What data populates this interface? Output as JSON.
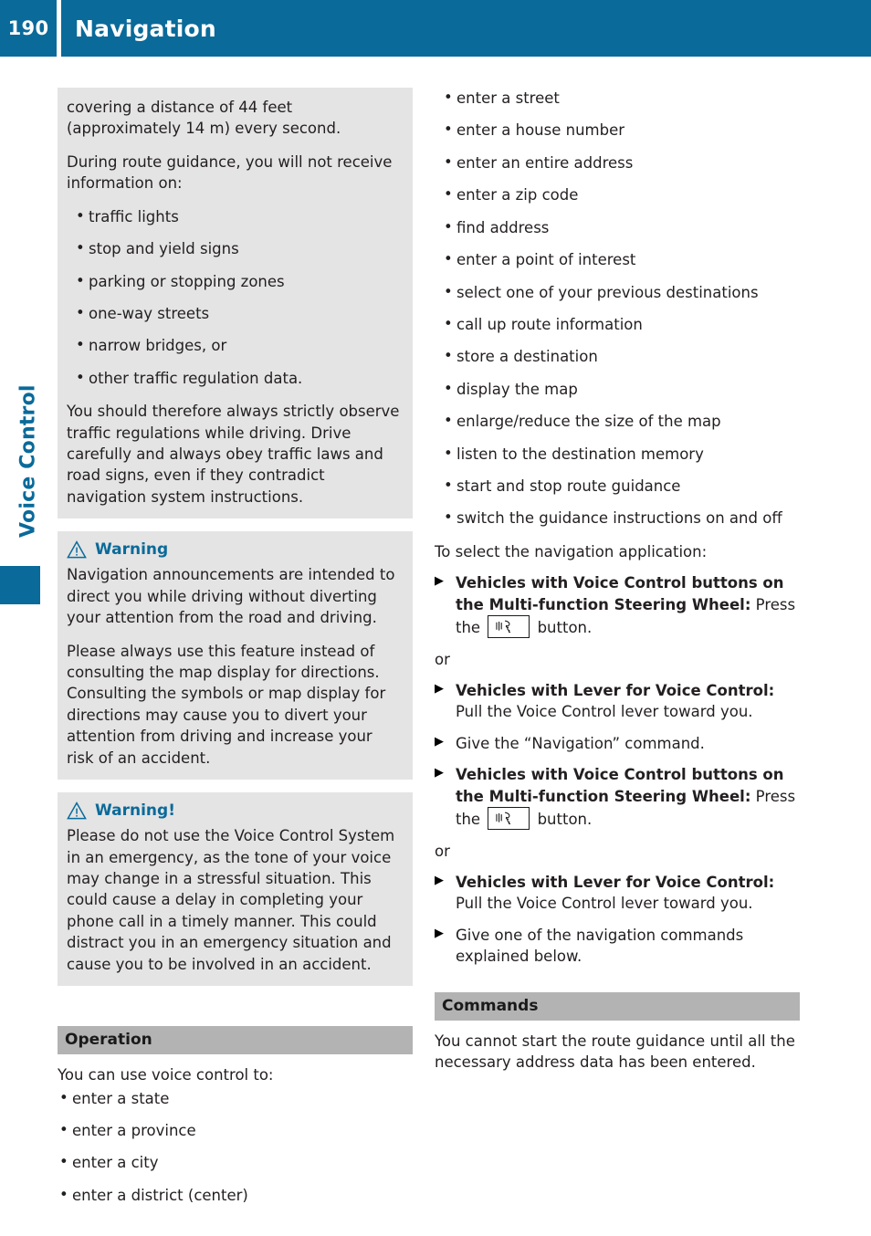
{
  "header": {
    "page_number": "190",
    "title": "Navigation",
    "bg_color": "#0a6a9a"
  },
  "side_tab": {
    "label": "Voice Control",
    "color": "#0a6a9a"
  },
  "left_column": {
    "intro_block": {
      "paragraphs": [
        "covering a distance of 44 feet (approximately 14 m) every second.",
        "During route guidance, you will not receive information on:"
      ],
      "bullets": [
        "traffic lights",
        "stop and yield signs",
        "parking or stopping zones",
        "one-way streets",
        "narrow bridges, or",
        "other traffic regulation data."
      ],
      "closing": "You should therefore always strictly observe traffic regulations while driving. Drive carefully and always obey traffic laws and road signs, even if they contradict navigation system instructions."
    },
    "warning_1": {
      "icon": "warning-triangle-icon",
      "title": "Warning",
      "paragraphs": [
        "Navigation announcements are intended to direct you while driving without diverting your attention from the road and driving.",
        "Please always use this feature instead of consulting the map display for directions. Consulting the symbols or map display for directions may cause you to divert your attention from driving and increase your risk of an accident."
      ]
    },
    "warning_2": {
      "icon": "warning-triangle-icon",
      "title": "Warning!",
      "paragraphs": [
        "Please do not use the Voice Control System in an emergency, as the tone of your voice may change in a stressful situation. This could cause a delay in completing your phone call in a timely manner. This could distract you in an emergency situation and cause you to be involved in an accident."
      ]
    },
    "operation": {
      "heading": "Operation",
      "intro": "You can use voice control to:",
      "bullets": [
        "enter a state",
        "enter a province",
        "enter a city",
        "enter a district (center)"
      ]
    }
  },
  "right_column": {
    "capabilities": [
      "enter a street",
      "enter a house number",
      "enter an entire address",
      "enter a zip code",
      "find address",
      "enter a point of interest",
      "select one of your previous destinations",
      "call up route information",
      "store a destination",
      "display the map",
      "enlarge/reduce the size of the map",
      "listen to the destination memory",
      "start and stop route guidance",
      "switch the guidance instructions on and off"
    ],
    "select_intro": "To select the navigation application:",
    "steps": [
      {
        "bold": "Vehicles with Voice Control buttons on the Multi-function Steering Wheel:",
        "text_before": " Press the ",
        "has_button": true,
        "button_icon": "voice-control-button-icon",
        "text_after": " button."
      },
      {
        "no_marker": true,
        "plain": "or"
      },
      {
        "bold": "Vehicles with Lever for Voice Control:",
        "text_after": " Pull the Voice Control lever toward you."
      },
      {
        "plain": "Give the “Navigation” command."
      },
      {
        "bold": "Vehicles with Voice Control buttons on the Multi-function Steering Wheel:",
        "text_before": " Press the ",
        "has_button": true,
        "button_icon": "voice-control-button-icon",
        "text_after": " button."
      },
      {
        "no_marker": true,
        "plain": "or"
      },
      {
        "bold": "Vehicles with Lever for Voice Control:",
        "text_after": " Pull the Voice Control lever toward you."
      },
      {
        "plain": "Give one of the navigation commands explained below."
      }
    ],
    "commands": {
      "heading": "Commands",
      "paragraph": "You cannot start the route guidance until all the necessary address data has been entered."
    }
  }
}
